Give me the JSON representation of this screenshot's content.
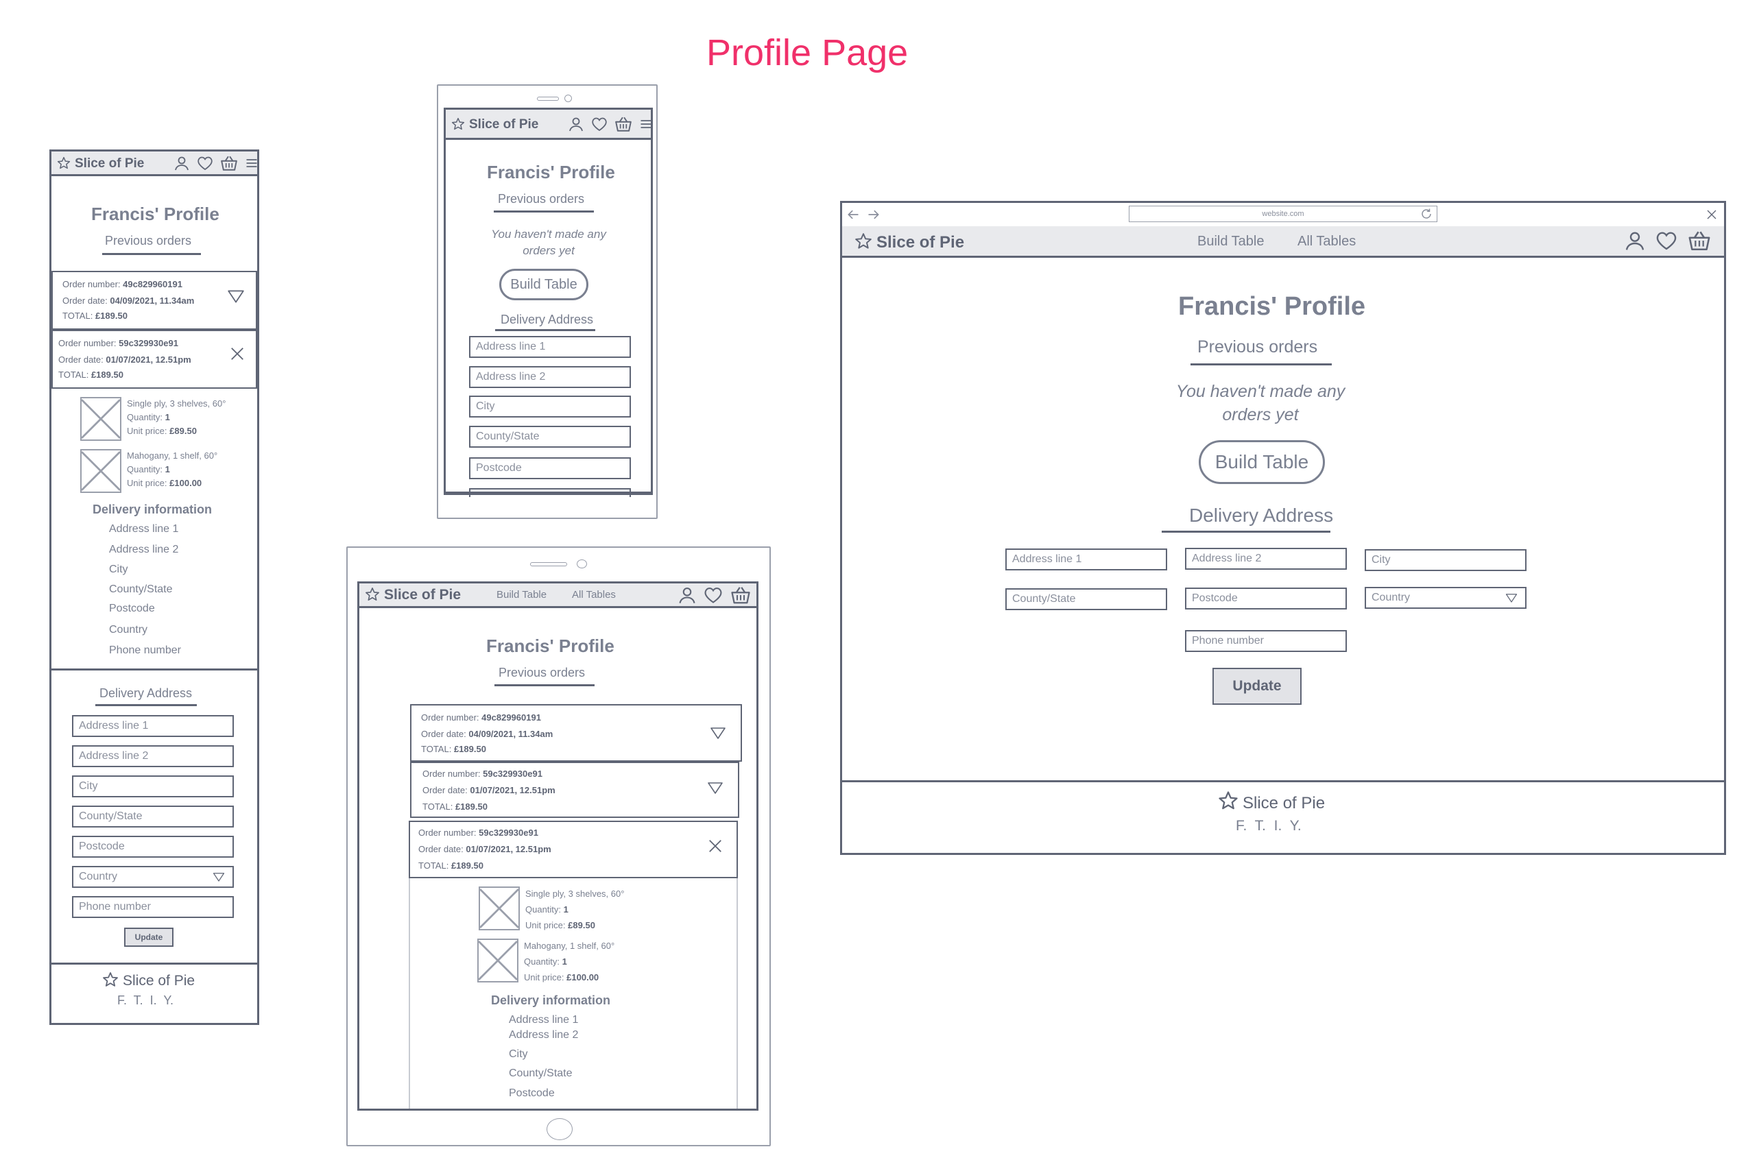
{
  "page_title": "Profile Page",
  "brand": "Slice of Pie",
  "nav": {
    "build_table": "Build Table",
    "all_tables": "All Tables"
  },
  "browser": {
    "url": "website.com"
  },
  "profile_title": "Francis' Profile",
  "previous_orders": "Previous orders",
  "no_orders_line1": "You haven't made any",
  "no_orders_line2": "orders yet",
  "build_table_button": "Build Table",
  "delivery_address": "Delivery Address",
  "delivery_information": "Delivery information",
  "fields": {
    "address1": "Address line 1",
    "address2": "Address line 2",
    "city": "City",
    "county": "County/State",
    "postcode": "Postcode",
    "country": "Country",
    "phone": "Phone number"
  },
  "update_button": "Update",
  "labels": {
    "order_number": "Order number:",
    "order_date": "Order date:",
    "total": "TOTAL:",
    "quantity": "Quantity:",
    "unit_price": "Unit price:"
  },
  "orders": [
    {
      "number": "49c829960191",
      "date": "04/09/2021, 11.34am",
      "total": "£189.50"
    },
    {
      "number": "59c329930e91",
      "date": "01/07/2021, 12.51pm",
      "total": "£189.50"
    }
  ],
  "items": [
    {
      "desc": "Single ply, 3 shelves, 60°",
      "quantity": "1",
      "price": "£89.50"
    },
    {
      "desc": "Mahogany, 1 shelf, 60°",
      "quantity": "1",
      "price": "£100.00"
    }
  ],
  "footer_social": "F.  T.  I.  Y.",
  "colors": {
    "title_accent": "#f0306a",
    "stroke": "#5f6575",
    "navbar_bg": "#e9eaed"
  }
}
